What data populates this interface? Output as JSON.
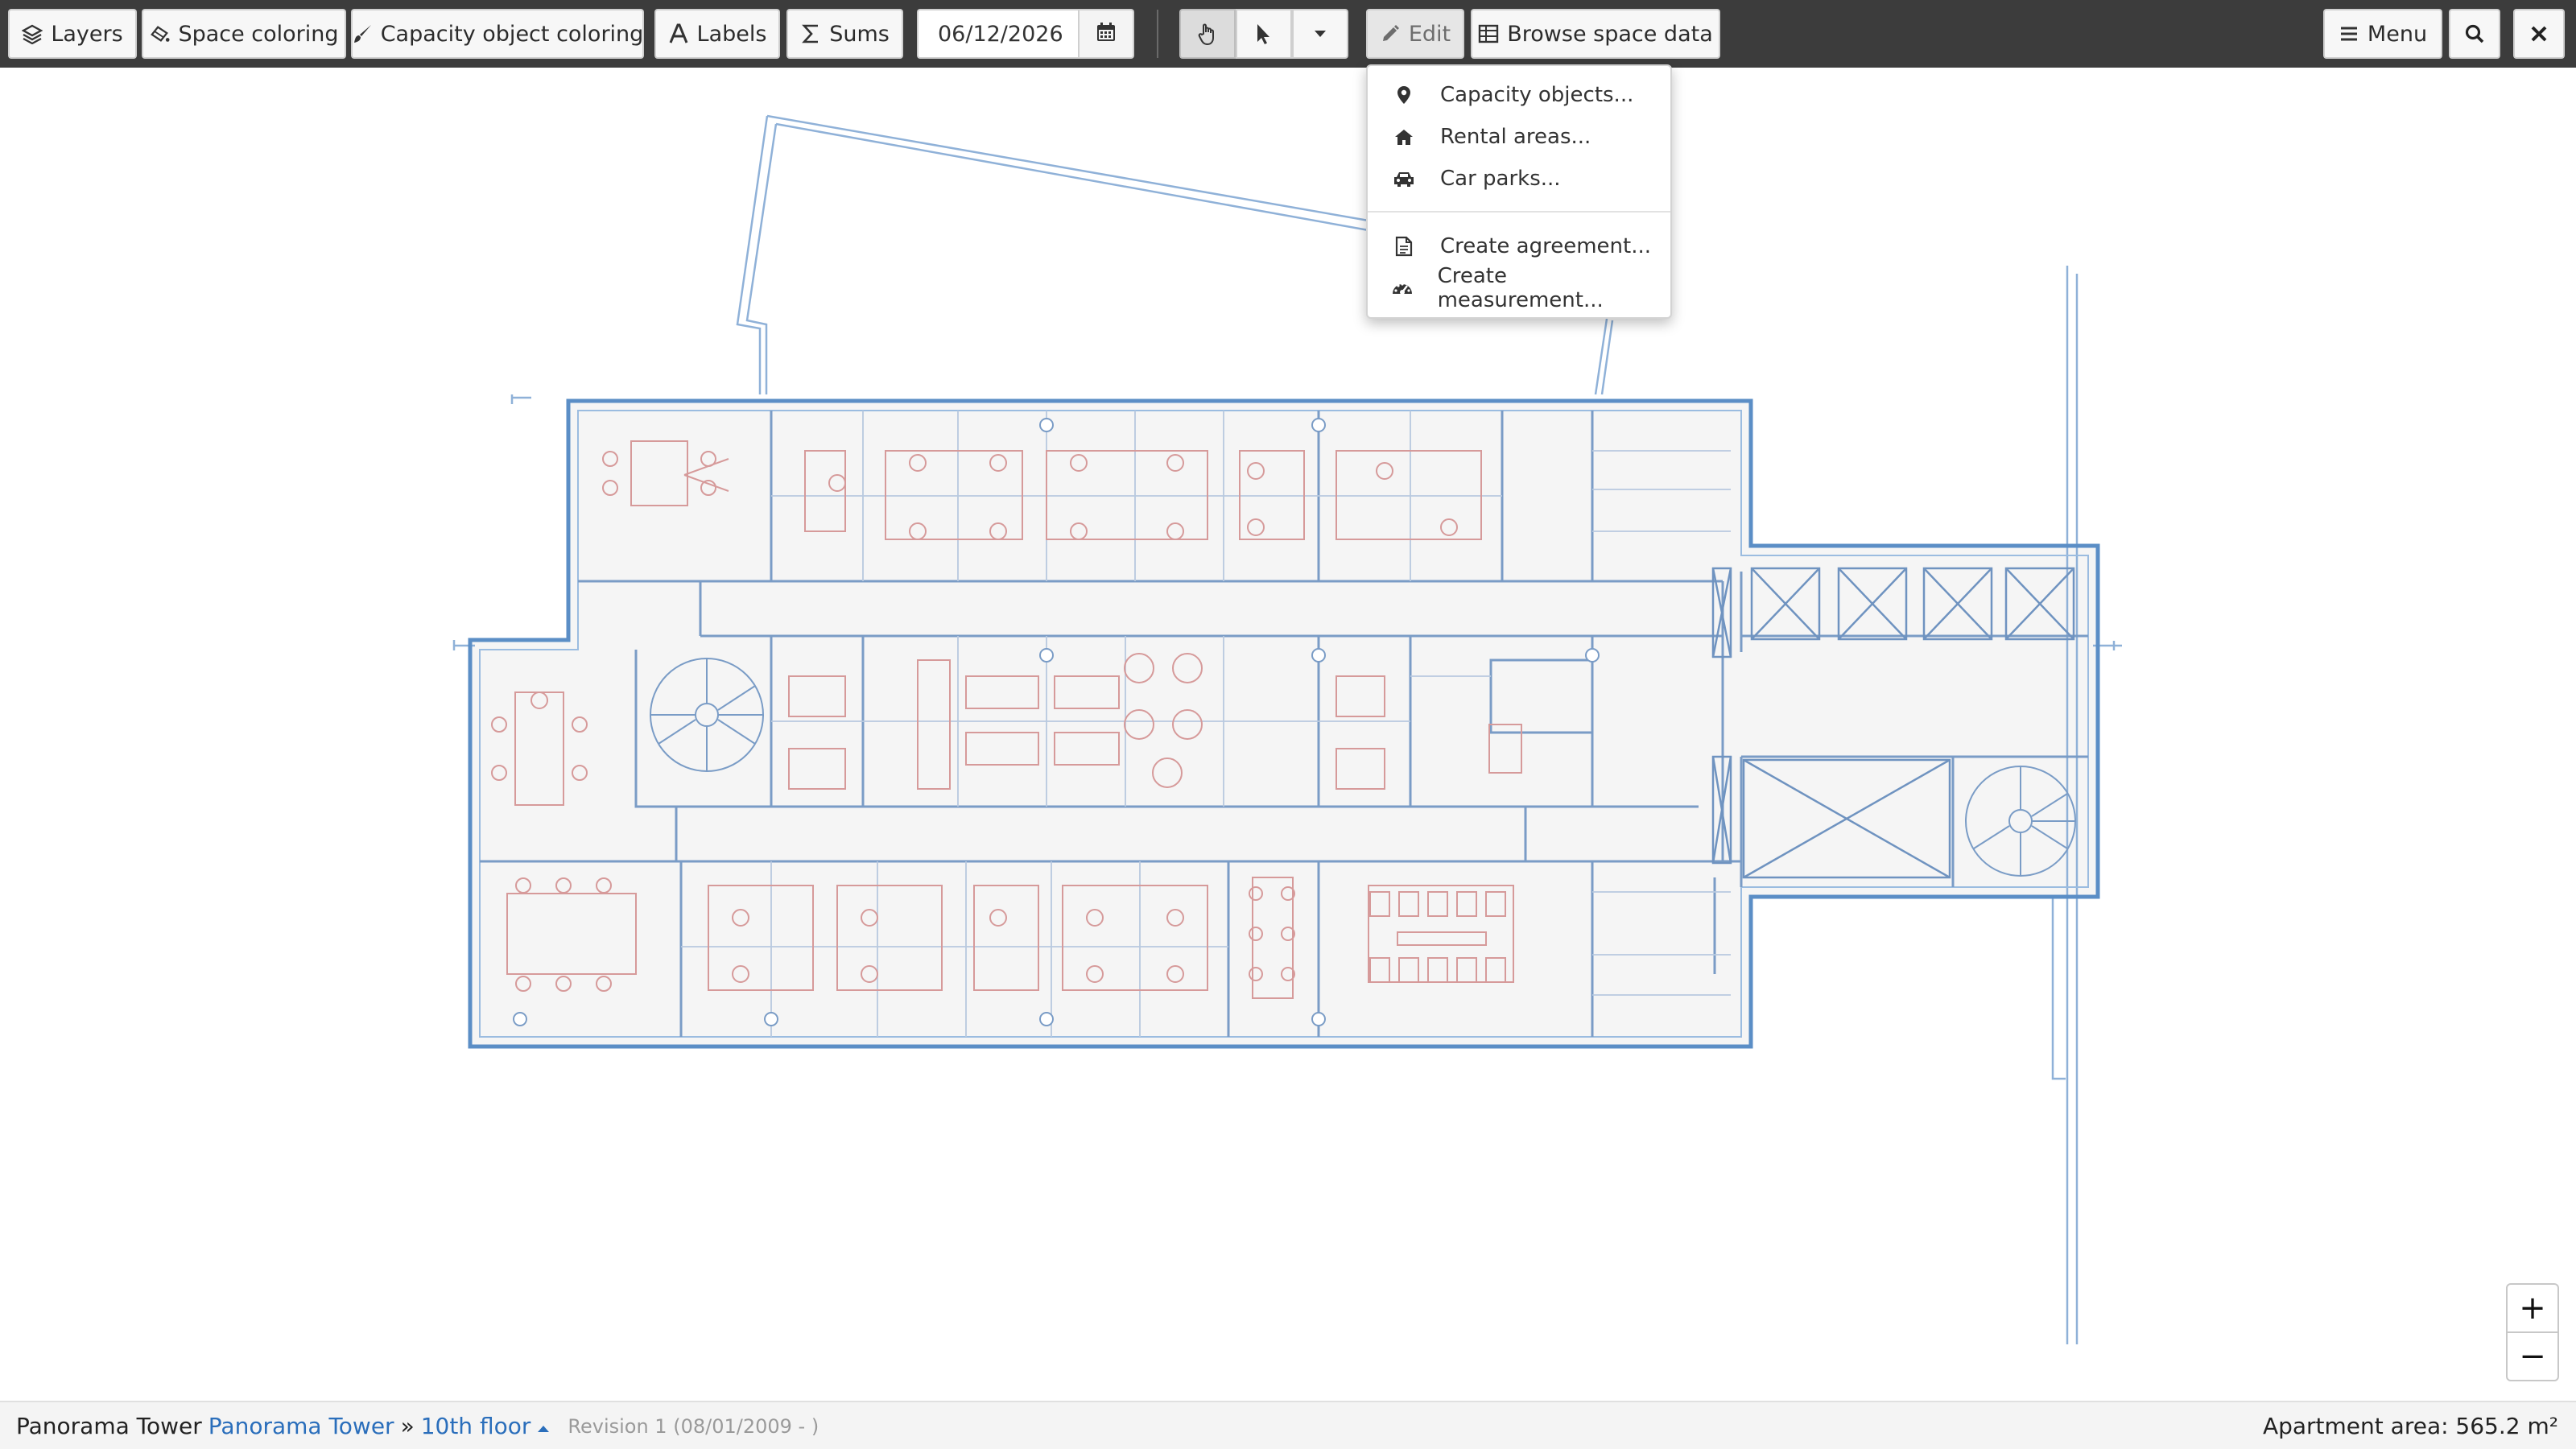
{
  "toolbar": {
    "layers": "Layers",
    "space_coloring": "Space coloring",
    "capacity_object_coloring": "Capacity object coloring",
    "labels": "Labels",
    "sums": "Sums",
    "date_value": "06/12/2026",
    "edit": "Edit",
    "browse_space_data": "Browse space data",
    "menu": "Menu",
    "icons": [
      "layers-icon",
      "space-coloring-icon",
      "brush-icon",
      "font-icon",
      "sigma-icon",
      "calendar-icon",
      "hand-pointer-icon",
      "cursor-arrow-icon",
      "caret-down-icon",
      "pencil-icon",
      "table-icon",
      "bars-icon",
      "search-icon",
      "close-icon"
    ]
  },
  "edit_menu": {
    "items": [
      {
        "label": "Capacity objects...",
        "icon": "map-marker-icon"
      },
      {
        "label": "Rental areas...",
        "icon": "home-icon"
      },
      {
        "label": "Car parks...",
        "icon": "car-icon"
      },
      {
        "label": "Create agreement...",
        "icon": "document-icon"
      },
      {
        "label": "Create measurement...",
        "icon": "gauge-icon"
      }
    ]
  },
  "zoom": {
    "in": "+",
    "out": "−"
  },
  "status": {
    "building": "Panorama Tower",
    "building_link": "Panorama Tower",
    "separator": "»",
    "floor": "10th floor",
    "revision": "Revision 1 (08/01/2009 - )",
    "area": "Apartment area: 565.2 m²"
  },
  "colors": {
    "toolbar_bg": "#3c3c3c",
    "wall_blue": "#5b8ec6",
    "furniture_red": "#d69a9a",
    "link_blue": "#2a6ebb"
  }
}
